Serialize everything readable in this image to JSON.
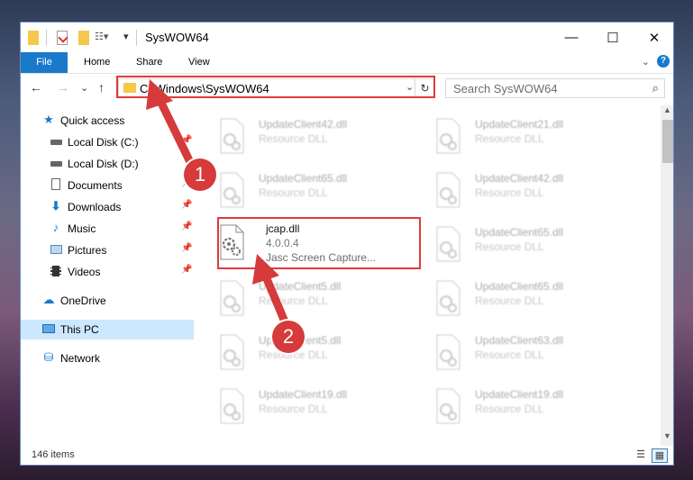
{
  "window": {
    "title": "SysWOW64",
    "controls": {
      "minimize": "—",
      "maximize": "☐",
      "close": "✕"
    }
  },
  "ribbon": {
    "tabs": [
      "File",
      "Home",
      "Share",
      "View"
    ],
    "help": "?",
    "collapse": "⌄"
  },
  "nav_buttons": {
    "back": "←",
    "forward": "→",
    "recent": "⌄",
    "up": "↑"
  },
  "address": {
    "path": "C:\\Windows\\SysWOW64",
    "dropdown": "⌄",
    "refresh": "↻"
  },
  "search": {
    "placeholder": "Search SysWOW64",
    "icon": "search-icon"
  },
  "sidebar": {
    "items": [
      {
        "label": "Quick access",
        "icon": "star-icon",
        "pinned": false
      },
      {
        "label": "Local Disk (C:)",
        "icon": "drive-icon",
        "pinned": true
      },
      {
        "label": "Local Disk (D:)",
        "icon": "drive-icon",
        "pinned": false
      },
      {
        "label": "Documents",
        "icon": "documents-icon",
        "pinned": true
      },
      {
        "label": "Downloads",
        "icon": "download-icon",
        "pinned": true
      },
      {
        "label": "Music",
        "icon": "music-icon",
        "pinned": true
      },
      {
        "label": "Pictures",
        "icon": "pictures-icon",
        "pinned": true
      },
      {
        "label": "Videos",
        "icon": "videos-icon",
        "pinned": true
      },
      {
        "label": "OneDrive",
        "icon": "cloud-icon",
        "pinned": false
      },
      {
        "label": "This PC",
        "icon": "computer-icon",
        "pinned": false,
        "selected": true
      },
      {
        "label": "Network",
        "icon": "network-icon",
        "pinned": false
      }
    ]
  },
  "files": [
    {
      "name": "UpdateClient42.dll",
      "desc": "Resource DLL"
    },
    {
      "name": "UpdateClient21.dll",
      "desc": "Resource DLL"
    },
    {
      "name": "UpdateClient65.dll",
      "desc": "Resource DLL"
    },
    {
      "name": "UpdateClient42.dll",
      "desc": "Resource DLL"
    },
    {
      "name": "jcap.dll",
      "version": "4.0.0.4",
      "desc": "Jasc Screen Capture..."
    },
    {
      "name": "UpdateClient65.dll",
      "desc": "Resource DLL"
    },
    {
      "name": "UpdateClient5.dll",
      "desc": "Resource DLL"
    },
    {
      "name": "UpdateClient65.dll",
      "desc": "Resource DLL"
    },
    {
      "name": "UpdateClient5.dll",
      "desc": "Resource DLL"
    },
    {
      "name": "UpdateClient63.dll",
      "desc": "Resource DLL"
    },
    {
      "name": "UpdateClient19.dll",
      "desc": "Resource DLL"
    },
    {
      "name": "UpdateClient19.dll",
      "desc": "Resource DLL"
    }
  ],
  "status": {
    "count": "146 items"
  },
  "callouts": [
    "1",
    "2"
  ],
  "colors": {
    "accent": "#1979ca",
    "highlight": "#e03a3a",
    "selected": "#cce8ff"
  }
}
